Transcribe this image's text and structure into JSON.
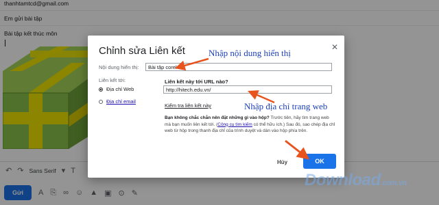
{
  "compose": {
    "to": "thanhtamtcd@gmail.com",
    "subject": "Em gửi bài tập",
    "body": "Bài tập kết thúc môn",
    "font_name": "Sans Serif",
    "send_label": "Gửi"
  },
  "dialog": {
    "title": "Chỉnh sửa Liên kết",
    "display_text_label": "Nội dung hiển thị:",
    "display_text_value": "Bài tập corel",
    "link_to_label": "Liên kết tới:",
    "option_web": "Địa chỉ Web",
    "option_email": "Địa chỉ email",
    "url_question": "Liên kết này tới URL nào?",
    "url_value": "http://hitech.edu.vn/",
    "test_link": "Kiểm tra liên kết này",
    "help_bold": "Bạn không chắc chắn nên đặt những gì vào hộp?",
    "help_text_1": " Trước tiên, hãy tìm trang web mà bạn muốn liên kết tới. (",
    "help_link": "Công cụ tìm kiếm",
    "help_text_2": " có thể hữu ích.) Sau đó, sao chép địa chỉ web từ hộp trong thanh địa chỉ của trình duyệt và dán vào hộp phía trên.",
    "cancel_label": "Hủy",
    "ok_label": "OK"
  },
  "annotations": {
    "display_note": "Nhập nội dung hiển thị",
    "url_note": "Nhập địa chỉ trang web"
  },
  "watermark": {
    "text": "Download",
    "suffix": ".com.vn"
  },
  "colors": {
    "accent": "#1a73e8",
    "arrow": "#e8541e",
    "annotation": "#1a3fb8",
    "gift_green": "#8bc34a",
    "gift_ribbon": "#f2e600"
  }
}
